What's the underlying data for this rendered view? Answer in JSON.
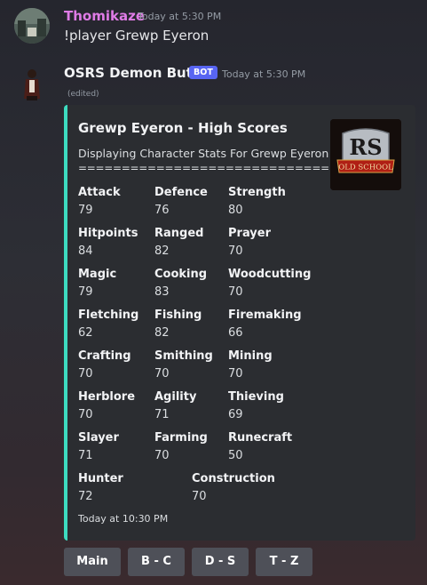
{
  "message1": {
    "username": "Thomikaze",
    "timestamp": "Today at 5:30 PM",
    "content": "!player Grewp Eyeron"
  },
  "message2": {
    "username": "OSRS Demon Butler",
    "badge": "BOT",
    "timestamp": "Today at 5:30 PM",
    "edited": "(edited)"
  },
  "embed": {
    "accent_color": "#3ddbc0",
    "title": "Grewp Eyeron - High Scores",
    "description_line1": "Displaying Character Stats For Grewp Eyeron",
    "description_line2": "==============================",
    "thumbnail": {
      "text_top": "RS",
      "text_bottom": "OLD SCHOOL"
    },
    "footer_timestamp": "Today at 10:30 PM",
    "stats": [
      {
        "name": "Attack",
        "value": "79"
      },
      {
        "name": "Defence",
        "value": "76"
      },
      {
        "name": "Strength",
        "value": "80"
      },
      {
        "name": "Hitpoints",
        "value": "84"
      },
      {
        "name": "Ranged",
        "value": "82"
      },
      {
        "name": "Prayer",
        "value": "70"
      },
      {
        "name": "Magic",
        "value": "79"
      },
      {
        "name": "Cooking",
        "value": "83"
      },
      {
        "name": "Woodcutting",
        "value": "70"
      },
      {
        "name": "Fletching",
        "value": "62"
      },
      {
        "name": "Fishing",
        "value": "82"
      },
      {
        "name": "Firemaking",
        "value": "66"
      },
      {
        "name": "Crafting",
        "value": "70"
      },
      {
        "name": "Smithing",
        "value": "70"
      },
      {
        "name": "Mining",
        "value": "70"
      },
      {
        "name": "Herblore",
        "value": "70"
      },
      {
        "name": "Agility",
        "value": "71"
      },
      {
        "name": "Thieving",
        "value": "69"
      },
      {
        "name": "Slayer",
        "value": "71"
      },
      {
        "name": "Farming",
        "value": "70"
      },
      {
        "name": "Runecraft",
        "value": "50"
      },
      {
        "name": "Hunter",
        "value": "72"
      },
      {
        "name": "Construction",
        "value": "70"
      }
    ]
  },
  "buttons": {
    "main": "Main",
    "b_c": "B - C",
    "d_s": "D - S",
    "t_z": "T - Z"
  }
}
